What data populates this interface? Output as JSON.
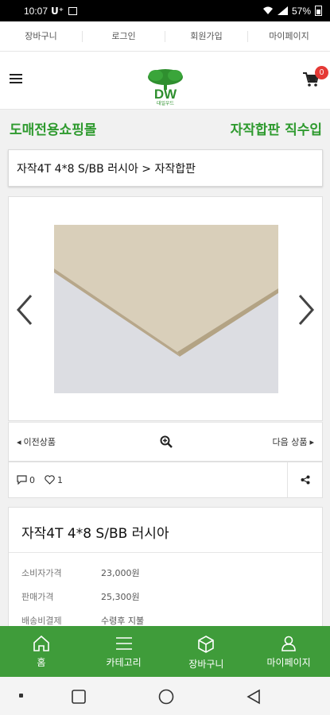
{
  "status_bar": {
    "time": "10:07",
    "carrier": "U⁺",
    "battery": "57%"
  },
  "top_nav": [
    {
      "label": "장바구니"
    },
    {
      "label": "로그인"
    },
    {
      "label": "회원가입"
    },
    {
      "label": "마이페이지"
    }
  ],
  "header": {
    "logo_text": "DW",
    "logo_sub": "대일우드",
    "cart_count": "0"
  },
  "banner": {
    "left": "도매전용쇼핑몰",
    "right": "자작합판 직수입"
  },
  "breadcrumb": "자작4T 4*8 S/BB 러시아 > 자작합판",
  "pager": {
    "prev": "이전상품",
    "next": "다음 상품"
  },
  "social": {
    "comments": "0",
    "likes": "1"
  },
  "product": {
    "title": "자작4T 4*8 S/BB 러시아",
    "rows": [
      {
        "key": "소비자가격",
        "value": "23,000원"
      },
      {
        "key": "판매가격",
        "value": "25,300원"
      },
      {
        "key": "배송비결제",
        "value": "수령후 지불"
      }
    ]
  },
  "tabbar": [
    {
      "label": "홈",
      "icon": "home-icon"
    },
    {
      "label": "카테고리",
      "icon": "menu-icon"
    },
    {
      "label": "장바구니",
      "icon": "box-icon"
    },
    {
      "label": "마이페이지",
      "icon": "user-icon"
    }
  ],
  "colors": {
    "brand_green": "#3f9c3a",
    "banner_green": "#2e9a2e",
    "badge_red": "#e53935"
  }
}
